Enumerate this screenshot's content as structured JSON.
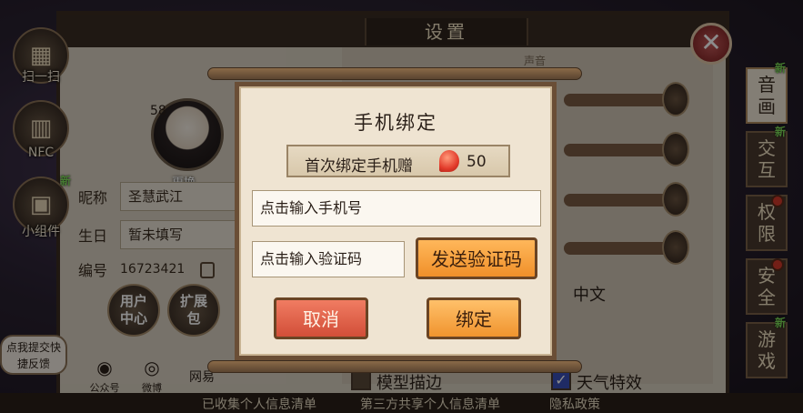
{
  "side_icons": [
    {
      "label": "扫一扫",
      "icon": "qr-scan-icon",
      "is_new": false
    },
    {
      "label": "NFC",
      "icon": "nfc-icon",
      "is_new": false
    },
    {
      "label": "小组件",
      "icon": "widget-icon",
      "is_new": true
    }
  ],
  "new_tag": "新",
  "settings": {
    "title": "设置",
    "avatar_level": "58",
    "avatar_change": "更换",
    "nickname_label": "昵称",
    "nickname_value": "圣慧武江",
    "birthday_label": "生日",
    "birthday_value": "暂未填写",
    "id_label": "编号",
    "id_value": "16723421",
    "user_center_label": "用户中心",
    "expansion_label": "扩展包",
    "wechat_label": "公众号",
    "weibo_label": "微博",
    "net_label": "网易",
    "sound_title": "声音",
    "language_value": "中文",
    "model_outline_label": "模型描边",
    "model_outline_checked": false,
    "weather_label": "天气特效",
    "weather_checked": true
  },
  "tabs": [
    {
      "label": "音画",
      "active": true,
      "is_new": true,
      "dot": false
    },
    {
      "label": "交互",
      "active": false,
      "is_new": true,
      "dot": false
    },
    {
      "label": "权限",
      "active": false,
      "is_new": false,
      "dot": true
    },
    {
      "label": "安全",
      "active": false,
      "is_new": false,
      "dot": true
    },
    {
      "label": "游戏",
      "active": false,
      "is_new": true,
      "dot": false
    }
  ],
  "bottom_links": [
    "已收集个人信息清单",
    "第三方共享个人信息清单",
    "隐私政策"
  ],
  "feedback": "点我提交快捷反馈",
  "modal": {
    "title": "手机绑定",
    "bonus_text": "首次绑定手机赠",
    "bonus_amount": "50",
    "phone_placeholder": "点击输入手机号",
    "code_placeholder": "点击输入验证码",
    "send_code": "发送验证码",
    "cancel": "取消",
    "bind": "绑定"
  },
  "colors": {
    "accent_orange": "#f0942e",
    "cancel_red": "#d24e38",
    "dot_red": "#d23a2a",
    "new_green": "#7fdc5a"
  }
}
